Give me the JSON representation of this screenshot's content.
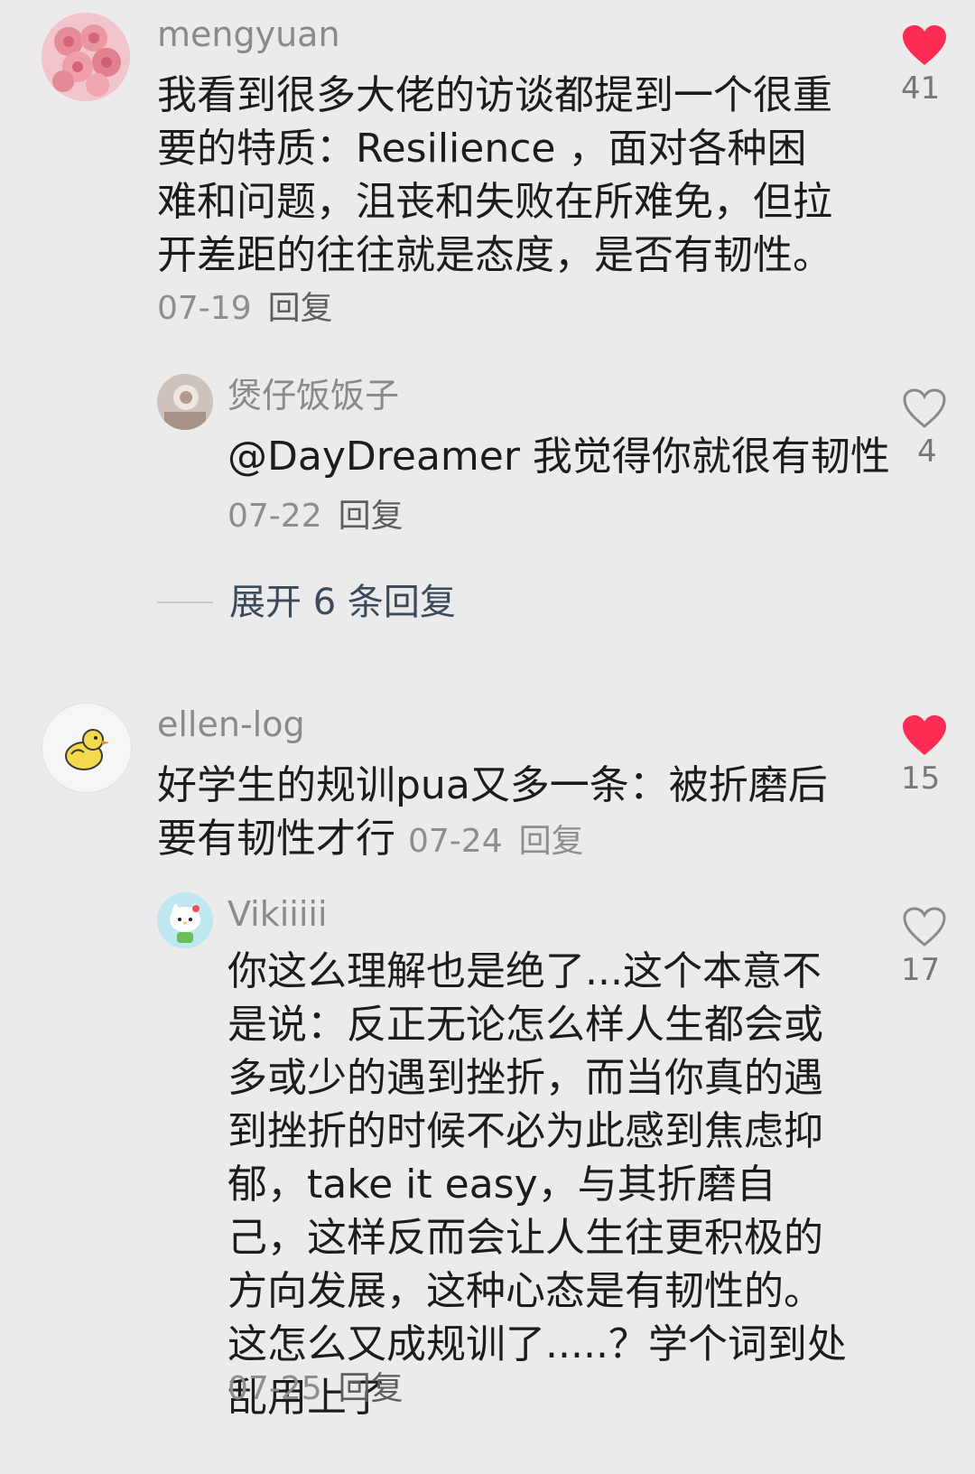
{
  "comments": [
    {
      "username": "mengyuan",
      "text": "我看到很多大佬的访谈都提到一个很重要的特质：Resilience ，面对各种困难和问题，沮丧和失败在所难免，但拉开差距的往往就是态度，是否有韧性。",
      "date": "07-19",
      "reply_label": "回复",
      "like_count": "41",
      "liked": true,
      "avatar_icon": "pink-roses-avatar",
      "replies": [
        {
          "username": "煲仔饭饭子",
          "text": "@DayDreamer 我觉得你就很有韧性",
          "date": "07-22",
          "reply_label": "回复",
          "like_count": "4",
          "liked": false,
          "avatar_icon": "photo-avatar"
        }
      ],
      "expand_label": "展开 6 条回复"
    },
    {
      "username": "ellen-log",
      "text": "好学生的规训pua又多一条：被折磨后要有韧性才行",
      "date": "07-24",
      "reply_label": "回复",
      "like_count": "15",
      "liked": true,
      "avatar_icon": "duck-avatar",
      "replies": [
        {
          "username": "Vikiiiii",
          "text": "你这么理解也是绝了...这个本意不是说：反正无论怎么样人生都会或多或少的遇到挫折，而当你真的遇到挫折的时候不必为此感到焦虑抑郁，take it easy，与其折磨自己，这样反而会让人生往更积极的方向发展，这种心态是有韧性的。这怎么又成规训了.....？学个词到处乱用上了",
          "date": "07-25",
          "reply_label": "回复",
          "like_count": "17",
          "liked": false,
          "avatar_icon": "hello-kitty-avatar"
        }
      ]
    }
  ],
  "colors": {
    "background": "#ebebeb",
    "like_active": "#fe2c55",
    "like_inactive": "#8a8a8a",
    "username": "#8a8a8a",
    "body_text": "#1c1c1c",
    "expand_text": "#3c4a5c"
  }
}
